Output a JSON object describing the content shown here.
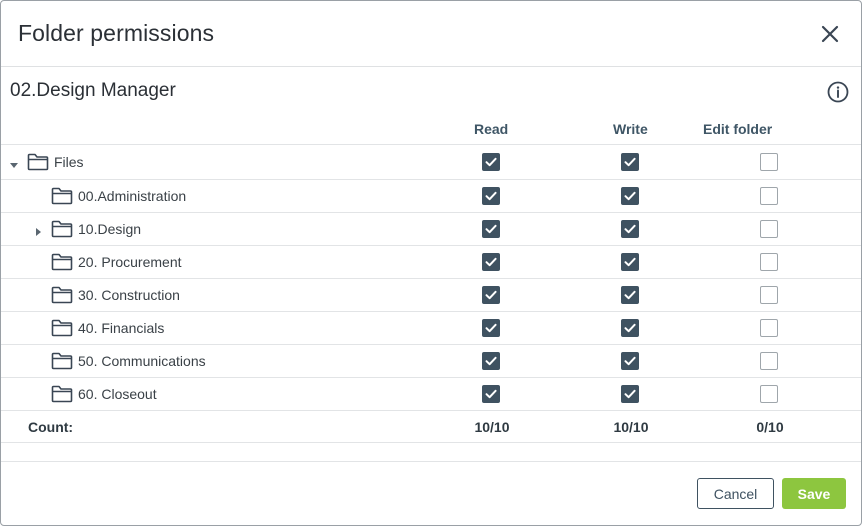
{
  "dialog": {
    "title": "Folder permissions",
    "group_name": "02.Design Manager",
    "columns": {
      "read": "Read",
      "write": "Write",
      "edit": "Edit folder"
    },
    "rows": [
      {
        "label": "Files",
        "level": 0,
        "caret": "expanded",
        "read": true,
        "write": true,
        "edit": false
      },
      {
        "label": "00.Administration",
        "level": 1,
        "caret": "none",
        "read": true,
        "write": true,
        "edit": false
      },
      {
        "label": "10.Design",
        "level": 1,
        "caret": "collapsed",
        "read": true,
        "write": true,
        "edit": false
      },
      {
        "label": "20. Procurement",
        "level": 1,
        "caret": "none",
        "read": true,
        "write": true,
        "edit": false
      },
      {
        "label": "30. Construction",
        "level": 1,
        "caret": "none",
        "read": true,
        "write": true,
        "edit": false
      },
      {
        "label": "40. Financials",
        "level": 1,
        "caret": "none",
        "read": true,
        "write": true,
        "edit": false
      },
      {
        "label": "50. Communications",
        "level": 1,
        "caret": "none",
        "read": true,
        "write": true,
        "edit": false
      },
      {
        "label": "60. Closeout",
        "level": 1,
        "caret": "none",
        "read": true,
        "write": true,
        "edit": false
      }
    ],
    "count": {
      "label": "Count:",
      "read": "10/10",
      "write": "10/10",
      "edit": "0/10"
    },
    "buttons": {
      "cancel": "Cancel",
      "save": "Save"
    },
    "icons": {
      "close": "close-icon",
      "info": "info-icon",
      "folder": "folder-icon",
      "caret_down": "caret-down-icon",
      "caret_right": "caret-right-icon"
    },
    "colors": {
      "checked": "#3f5261",
      "save": "#8dc63f",
      "column_header": "#3f5666"
    }
  }
}
